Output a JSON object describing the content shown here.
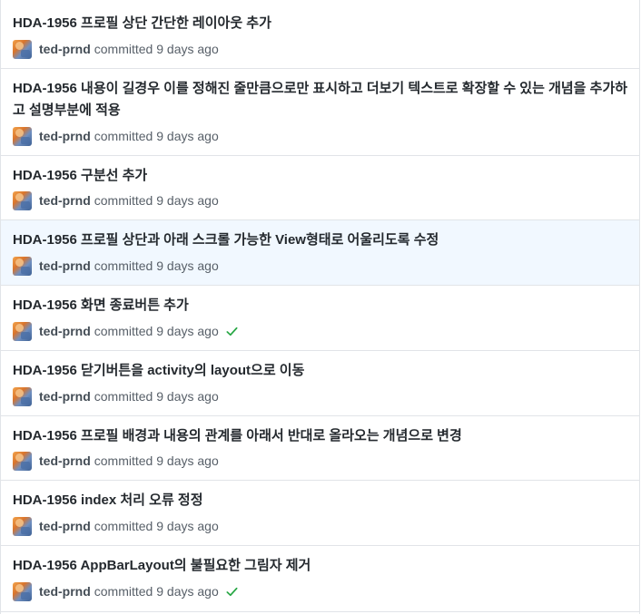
{
  "commits": [
    {
      "title": "HDA-1956 프로필 상단 간단한 레이아웃 추가",
      "author": "ted-prnd",
      "committed_text": "committed 9 days ago",
      "verified": false
    },
    {
      "title": "HDA-1956 내용이 길경우 이를 정해진 줄만큼으로만 표시하고 더보기 텍스트로 확장할 수 있는 개념을 추가하고 설명부분에 적용",
      "author": "ted-prnd",
      "committed_text": "committed 9 days ago",
      "verified": false
    },
    {
      "title": "HDA-1956 구분선 추가",
      "author": "ted-prnd",
      "committed_text": "committed 9 days ago",
      "verified": false
    },
    {
      "title": "HDA-1956 프로필 상단과 아래 스크롤 가능한 View형태로 어울리도록 수정",
      "author": "ted-prnd",
      "committed_text": "committed 9 days ago",
      "verified": false
    },
    {
      "title": "HDA-1956 화면 종료버튼 추가",
      "author": "ted-prnd",
      "committed_text": "committed 9 days ago",
      "verified": true
    },
    {
      "title": "HDA-1956 닫기버튼을 activity의 layout으로 이동",
      "author": "ted-prnd",
      "committed_text": "committed 9 days ago",
      "verified": false
    },
    {
      "title": "HDA-1956 프로필 배경과 내용의 관계를 아래서 반대로 올라오는 개념으로 변경",
      "author": "ted-prnd",
      "committed_text": "committed 9 days ago",
      "verified": false
    },
    {
      "title": "HDA-1956 index 처리 오류 정정",
      "author": "ted-prnd",
      "committed_text": "committed 9 days ago",
      "verified": false
    },
    {
      "title": "HDA-1956 AppBarLayout의 불필요한 그림자 제거",
      "author": "ted-prnd",
      "committed_text": "committed 9 days ago",
      "verified": true
    }
  ],
  "colors": {
    "highlight_row": "#f1f8ff",
    "verified_check": "#28a745",
    "border": "#e1e4e8"
  },
  "icons": {
    "avatar": "avatar",
    "verified": "check-icon"
  }
}
